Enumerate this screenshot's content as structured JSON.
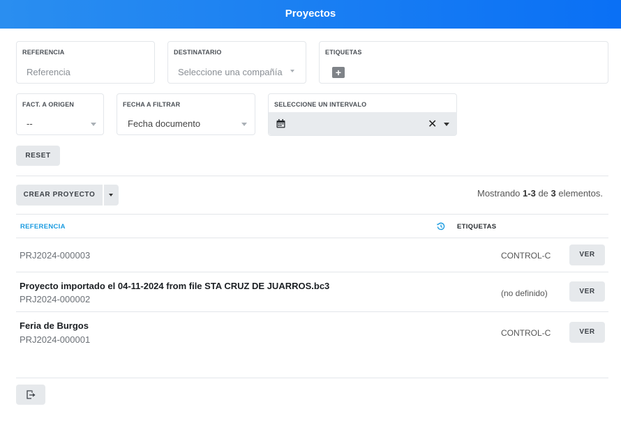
{
  "header": {
    "title": "Proyectos"
  },
  "filters": {
    "referencia": {
      "label": "REFERENCIA",
      "placeholder": "Referencia"
    },
    "destinatario": {
      "label": "DESTINATARIO",
      "placeholder": "Seleccione una compañía"
    },
    "etiquetas": {
      "label": "ETIQUETAS",
      "add": "+"
    },
    "fact_origen": {
      "label": "FACT. A ORIGEN",
      "value": "--"
    },
    "fecha_filtrar": {
      "label": "FECHA A FILTRAR",
      "value": "Fecha documento"
    },
    "intervalo": {
      "label": "SELECCIONE UN INTERVALO",
      "clear": "✕"
    }
  },
  "toolbar": {
    "reset": "RESET",
    "create": "CREAR PROYECTO"
  },
  "summary": {
    "prefix": "Mostrando",
    "range": "1-3",
    "of": "de",
    "total": "3",
    "suffix": "elementos."
  },
  "table": {
    "headers": {
      "referencia": "REFERENCIA",
      "etiquetas": "ETIQUETAS"
    },
    "rows": [
      {
        "title": "",
        "ref": "PRJ2024-000003",
        "tag": "CONTROL-C",
        "action": "VER"
      },
      {
        "title": "Proyecto importado el 04-11-2024 from file STA CRUZ DE JUARROS.bc3",
        "ref": "PRJ2024-000002",
        "tag": "(no definido)",
        "action": "VER"
      },
      {
        "title": "Feria de Burgos",
        "ref": "PRJ2024-000001",
        "tag": "CONTROL-C",
        "action": "VER"
      }
    ]
  },
  "colors": {
    "accent": "#0a70f5",
    "link": "#1a9be0",
    "button_bg": "#e6e9ec"
  },
  "icons": {
    "calendar": "calendar-icon",
    "history": "history-icon",
    "export": "export-icon"
  }
}
